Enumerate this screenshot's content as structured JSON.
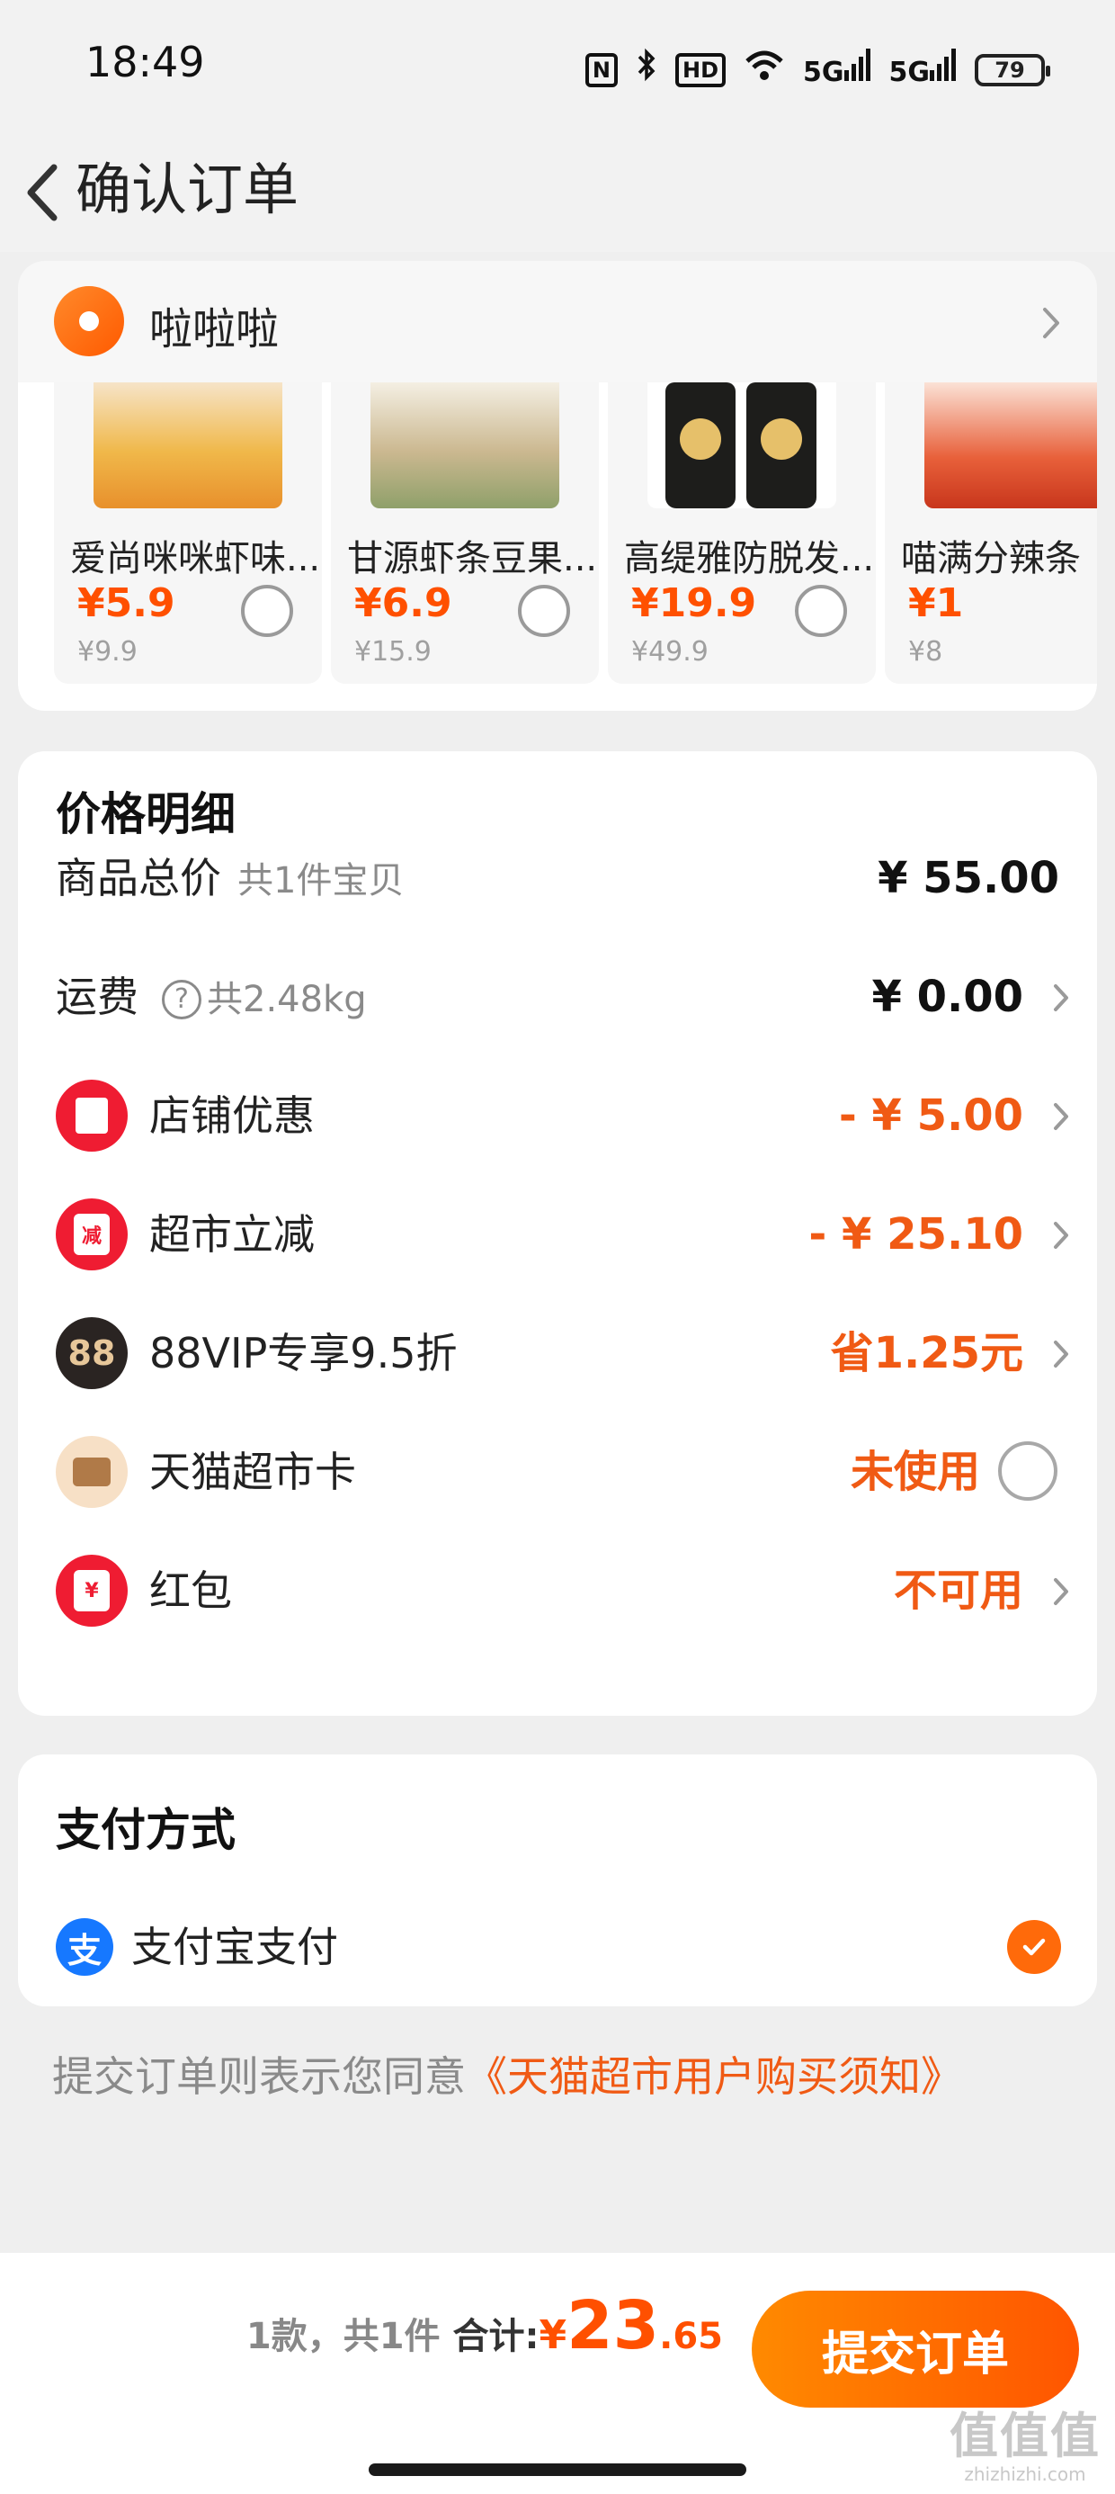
{
  "status_bar": {
    "time": "18:49",
    "icons": [
      "nfc-icon",
      "bluetooth-icon",
      "hd-icon",
      "wifi-icon",
      "signal-5g-icon",
      "signal-5g-icon",
      "battery-icon"
    ],
    "hd_label": "HD",
    "net_label_1": "5G",
    "net_label_2": "5G",
    "battery_level": "79"
  },
  "header": {
    "title": "确认订单",
    "back_icon": "chevron-left-icon"
  },
  "address": {
    "name": "啦啦啦",
    "icon": "location-pin-icon"
  },
  "products": [
    {
      "name": "爱尚咪咪虾味...",
      "price": "¥5.9",
      "original_price": "¥9.9"
    },
    {
      "name": "甘源虾条豆果...",
      "price": "¥6.9",
      "original_price": "¥15.9"
    },
    {
      "name": "高缇雅防脱发...",
      "price": "¥19.9",
      "original_price": "¥49.9"
    },
    {
      "name": "喵满分辣条",
      "price": "¥1",
      "original_price": "¥8"
    }
  ],
  "price_detail": {
    "title": "价格明细",
    "total": {
      "label": "商品总价",
      "sub": "共1件宝贝",
      "value": "¥ 55.00"
    },
    "shipping": {
      "label": "运费",
      "help": "?",
      "sub": "共2.48kg",
      "value": "¥ 0.00"
    },
    "shop_discount": {
      "label": "店铺优惠",
      "value": "- ¥ 5.00",
      "icon": "coupon-icon"
    },
    "market_discount": {
      "label": "超市立减",
      "value": "- ¥ 25.10",
      "icon": "reduce-icon",
      "icon_text": "减"
    },
    "vip": {
      "label": "88VIP专享9.5折",
      "value": "省1.25元",
      "icon": "vip-88-icon",
      "icon_text": "88"
    },
    "market_card": {
      "label": "天猫超市卡",
      "value": "未使用",
      "icon": "card-icon"
    },
    "red_packet": {
      "label": "红包",
      "value": "不可用",
      "icon": "red-packet-icon",
      "icon_text": "¥"
    }
  },
  "payment": {
    "title": "支付方式",
    "method": "支付宝支付",
    "method_icon_text": "支",
    "method_icon": "alipay-icon",
    "selected": true
  },
  "agreement": {
    "text": "提交订单则表示您同意",
    "link": "《天猫超市用户购买须知》"
  },
  "bottom_bar": {
    "count_text": "1款，共1件",
    "total_label": "合计:",
    "yen": "¥",
    "total_integer": "23",
    "total_decimal": ".65",
    "submit_label": "提交订单"
  },
  "watermark": {
    "mark": "值值值",
    "url": "zhizhizhi.com"
  },
  "colors": {
    "accent": "#ff5000",
    "discount": "#f05a14",
    "alipay": "#1678ff",
    "background": "#efefef"
  }
}
